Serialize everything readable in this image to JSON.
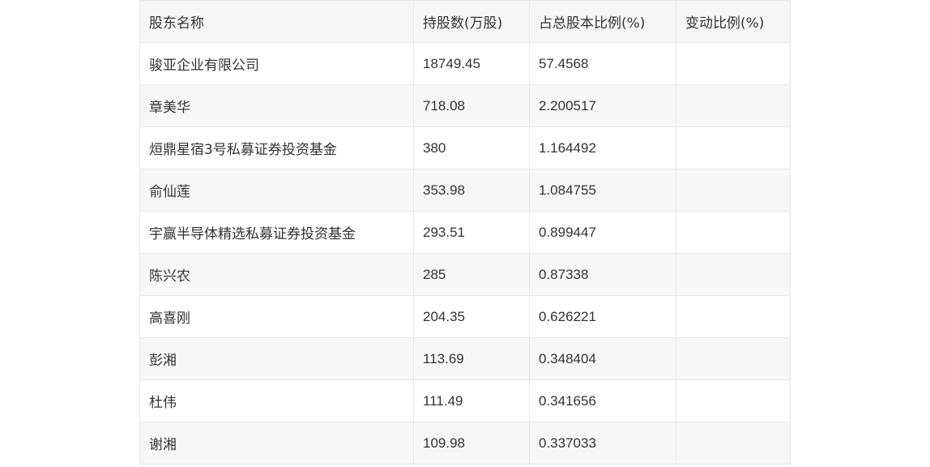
{
  "table": {
    "headers": [
      "股东名称",
      "持股数(万股)",
      "占总股本比例(%)",
      "变动比例(%)"
    ],
    "rows": [
      {
        "name": "骏亚企业有限公司",
        "shares": "18749.45",
        "ratio": "57.4568",
        "change": ""
      },
      {
        "name": "章美华",
        "shares": "718.08",
        "ratio": "2.200517",
        "change": ""
      },
      {
        "name": "烜鼎星宿3号私募证券投资基金",
        "shares": "380",
        "ratio": "1.164492",
        "change": ""
      },
      {
        "name": "俞仙莲",
        "shares": "353.98",
        "ratio": "1.084755",
        "change": ""
      },
      {
        "name": "宇赢半导体精选私募证券投资基金",
        "shares": "293.51",
        "ratio": "0.899447",
        "change": ""
      },
      {
        "name": "陈兴农",
        "shares": "285",
        "ratio": "0.87338",
        "change": ""
      },
      {
        "name": "高喜刚",
        "shares": "204.35",
        "ratio": "0.626221",
        "change": ""
      },
      {
        "name": "彭湘",
        "shares": "113.69",
        "ratio": "0.348404",
        "change": ""
      },
      {
        "name": "杜伟",
        "shares": "111.49",
        "ratio": "0.341656",
        "change": ""
      },
      {
        "name": "谢湘",
        "shares": "109.98",
        "ratio": "0.337033",
        "change": ""
      }
    ]
  }
}
